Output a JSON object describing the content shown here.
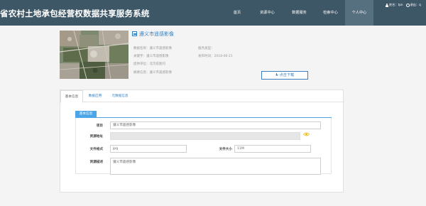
{
  "header": {
    "site_title": "省农村土地承包经营权数据共享服务系统",
    "nav": [
      {
        "label": "首页",
        "active": false
      },
      {
        "label": "资源中心",
        "active": false
      },
      {
        "label": "数据服务",
        "active": false
      },
      {
        "label": "检索中心",
        "active": false
      },
      {
        "label": "个人中心",
        "active": true
      }
    ],
    "user": {
      "name_label": "姓名：tpn",
      "logout_label": "退出：q"
    }
  },
  "resource": {
    "title": "遵义市遥感影像",
    "meta": {
      "data_name": "数据名称：遵义市遥感影像",
      "keywords": "关键字：遵义市遥感影像",
      "provider": "提供单位：北京航图司",
      "note": "摘要信息：遵义市遥感影像",
      "service_type": "服务类型：",
      "publish_time": "发布时间：2018-06-21"
    },
    "download_label": "点击下载"
  },
  "tabs": [
    {
      "label": "基本信息",
      "active": true
    },
    {
      "label": "数据应用",
      "active": false
    },
    {
      "label": "元数据信息",
      "active": false
    }
  ],
  "form": {
    "section_label": "基本信息",
    "project": {
      "label": "项目",
      "value": "遵义市遥感影像"
    },
    "address": {
      "label": "资源地址",
      "value": ""
    },
    "format": {
      "label": "文件格式",
      "value": "jpg"
    },
    "size": {
      "label": "文件大小",
      "value": "11M"
    },
    "description": {
      "label": "资源描述",
      "value": "遵义市遥感影像"
    }
  },
  "colors": {
    "header_bg": "#3e5766",
    "accent": "#2f7fc3",
    "badge": "#4aa6e8",
    "eye": "#e8b400"
  },
  "icons": {
    "user": "user-icon",
    "logout": "power-icon",
    "download": "download-arrow-icon",
    "image": "image-icon",
    "eye": "eye-icon"
  }
}
